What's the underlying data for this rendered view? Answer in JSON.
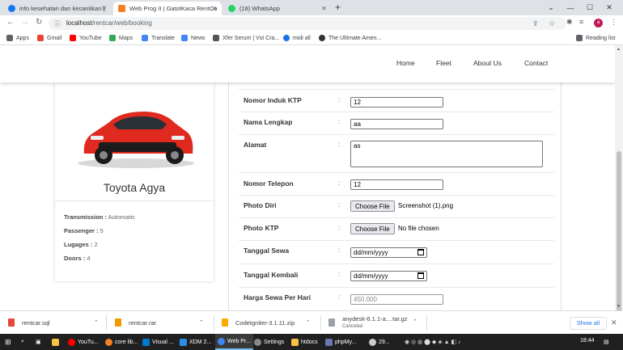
{
  "browser": {
    "tabs": [
      {
        "label": "info kesehatan dan kecantikan | ",
        "color": "#1877f2"
      },
      {
        "label": "Web Prog II | GatotKaca RentCar",
        "color": "#f48024"
      },
      {
        "label": "(18) WhatsApp",
        "color": "#25d366"
      }
    ],
    "url_host": "localhost",
    "url_path": "/rentcar/web/booking",
    "avatar_letter": "a",
    "bookmarks": [
      {
        "label": "Apps",
        "color": "#5f6368"
      },
      {
        "label": "Gmail",
        "color": "#ea4335"
      },
      {
        "label": "YouTube",
        "color": "#ff0000"
      },
      {
        "label": "Maps",
        "color": "#34a853"
      },
      {
        "label": "Translate",
        "color": "#4285f4"
      },
      {
        "label": "News",
        "color": "#4285f4"
      },
      {
        "label": "Xfer Serum | Vst Cra...",
        "color": "#555555"
      },
      {
        "label": "midi all",
        "color": "#1a73e8"
      },
      {
        "label": "The Ultimate Amen...",
        "color": "#333333"
      }
    ],
    "reading_list": "Reading list"
  },
  "site_nav": {
    "home": "Home",
    "fleet": "Fleet",
    "about": "About Us",
    "contact": "Contact"
  },
  "car": {
    "name": "Toyota Agya",
    "color": "#e02a1f",
    "specs": [
      {
        "label": "Transmission :",
        "value": " Automatic"
      },
      {
        "label": "Passenger :",
        "value": " 5"
      },
      {
        "label": "Lugages :",
        "value": " 2"
      },
      {
        "label": "Doors :",
        "value": " 4"
      }
    ]
  },
  "form": {
    "colon": ":",
    "ktp": {
      "label": "Nomor Induk KTP",
      "value": "12"
    },
    "nama": {
      "label": "Nama Lengkap",
      "value": "aa"
    },
    "alamat": {
      "label": "Alamat",
      "value": "as"
    },
    "telepon": {
      "label": "Nomor Telepon",
      "value": "12"
    },
    "photo_diri": {
      "label": "Photo Diri",
      "button": "Choose File",
      "file": "Screenshot (1).png"
    },
    "photo_ktp": {
      "label": "Photo KTP",
      "button": "Choose File",
      "file": "No file chosen"
    },
    "tanggal_sewa": {
      "label": "Tanggal Sewa",
      "placeholder": "dd/mm/yyyy"
    },
    "tanggal_kembali": {
      "label": "Tanggal Kembali",
      "placeholder": "dd/mm/yyyy"
    },
    "harga": {
      "label": "Harga Sewa Per Hari",
      "value": "450.000"
    }
  },
  "downloads": [
    {
      "name": "rentcar.sql",
      "color": "#e8453c"
    },
    {
      "name": "rentcar.rar",
      "color": "#f29900"
    },
    {
      "name": "CodeIgniter-3.1.11.zip",
      "color": "#f9ab00"
    },
    {
      "name": "anydesk-6.1.1-a....tar.gz",
      "status": "Canceled",
      "color": "#9aa0a6"
    }
  ],
  "show_all": "Show all",
  "taskbar": {
    "items": [
      {
        "label": "YouTu...",
        "color": "#ff0000"
      },
      {
        "label": "core lib...",
        "color": "#f48024"
      },
      {
        "label": "Visual ...",
        "color": "#007acc"
      },
      {
        "label": "XDM 2...",
        "color": "#2a8ee6"
      },
      {
        "label": "Web Pr...",
        "color": "#4285f4"
      },
      {
        "label": "Settings",
        "color": "#888888"
      },
      {
        "label": "htdocs",
        "color": "#f6c343"
      },
      {
        "label": "phpMy...",
        "color": "#6c78af"
      }
    ],
    "weather": "29...",
    "time": "18:44"
  }
}
